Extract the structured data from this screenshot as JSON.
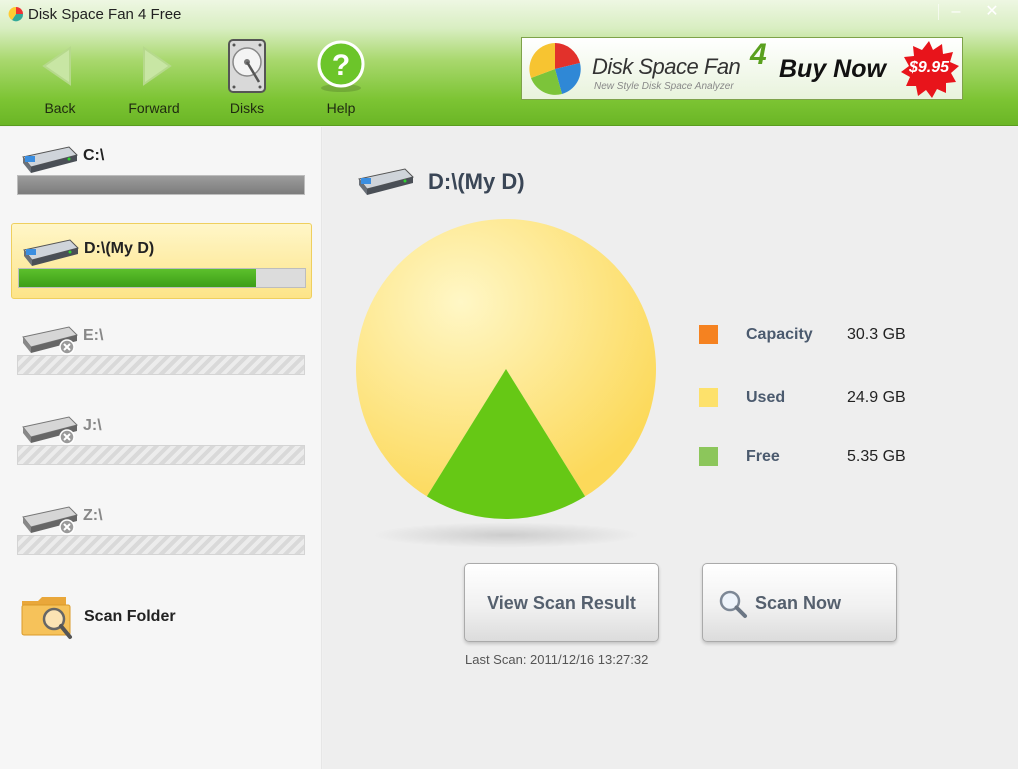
{
  "window": {
    "title": "Disk Space Fan 4 Free",
    "minimize": "–",
    "close": "✕"
  },
  "toolbar": {
    "back": "Back",
    "forward": "Forward",
    "disks": "Disks",
    "help": "Help"
  },
  "banner": {
    "product": "Disk Space Fan",
    "version": "4",
    "tagline": "New Style Disk Space Analyzer",
    "cta": "Buy Now",
    "price": "$9.95"
  },
  "drives": [
    {
      "label": "C:\\",
      "state": "full",
      "used_fraction": 1.0
    },
    {
      "label": "D:\\(My D)",
      "state": "selected",
      "used_fraction": 0.83
    },
    {
      "label": "E:\\",
      "state": "unavailable"
    },
    {
      "label": "J:\\",
      "state": "unavailable"
    },
    {
      "label": "Z:\\",
      "state": "unavailable"
    }
  ],
  "scan_folder": {
    "label": "Scan Folder"
  },
  "details": {
    "title": "D:\\(My D)",
    "legend": [
      {
        "label": "Capacity",
        "value": "30.3 GB",
        "color": "#f58220"
      },
      {
        "label": "Used",
        "value": "24.9 GB",
        "color": "#fde16b"
      },
      {
        "label": "Free",
        "value": "5.35 GB",
        "color": "#8cc65b"
      }
    ],
    "view_button": "View Scan Result",
    "scan_button": "Scan Now",
    "last_scan": "Last Scan: 2011/12/16 13:27:32"
  },
  "chart_data": {
    "type": "pie",
    "categories": [
      "Used",
      "Free"
    ],
    "values": [
      24.9,
      5.35
    ],
    "colors": [
      "#fde16b",
      "#66c815"
    ]
  }
}
